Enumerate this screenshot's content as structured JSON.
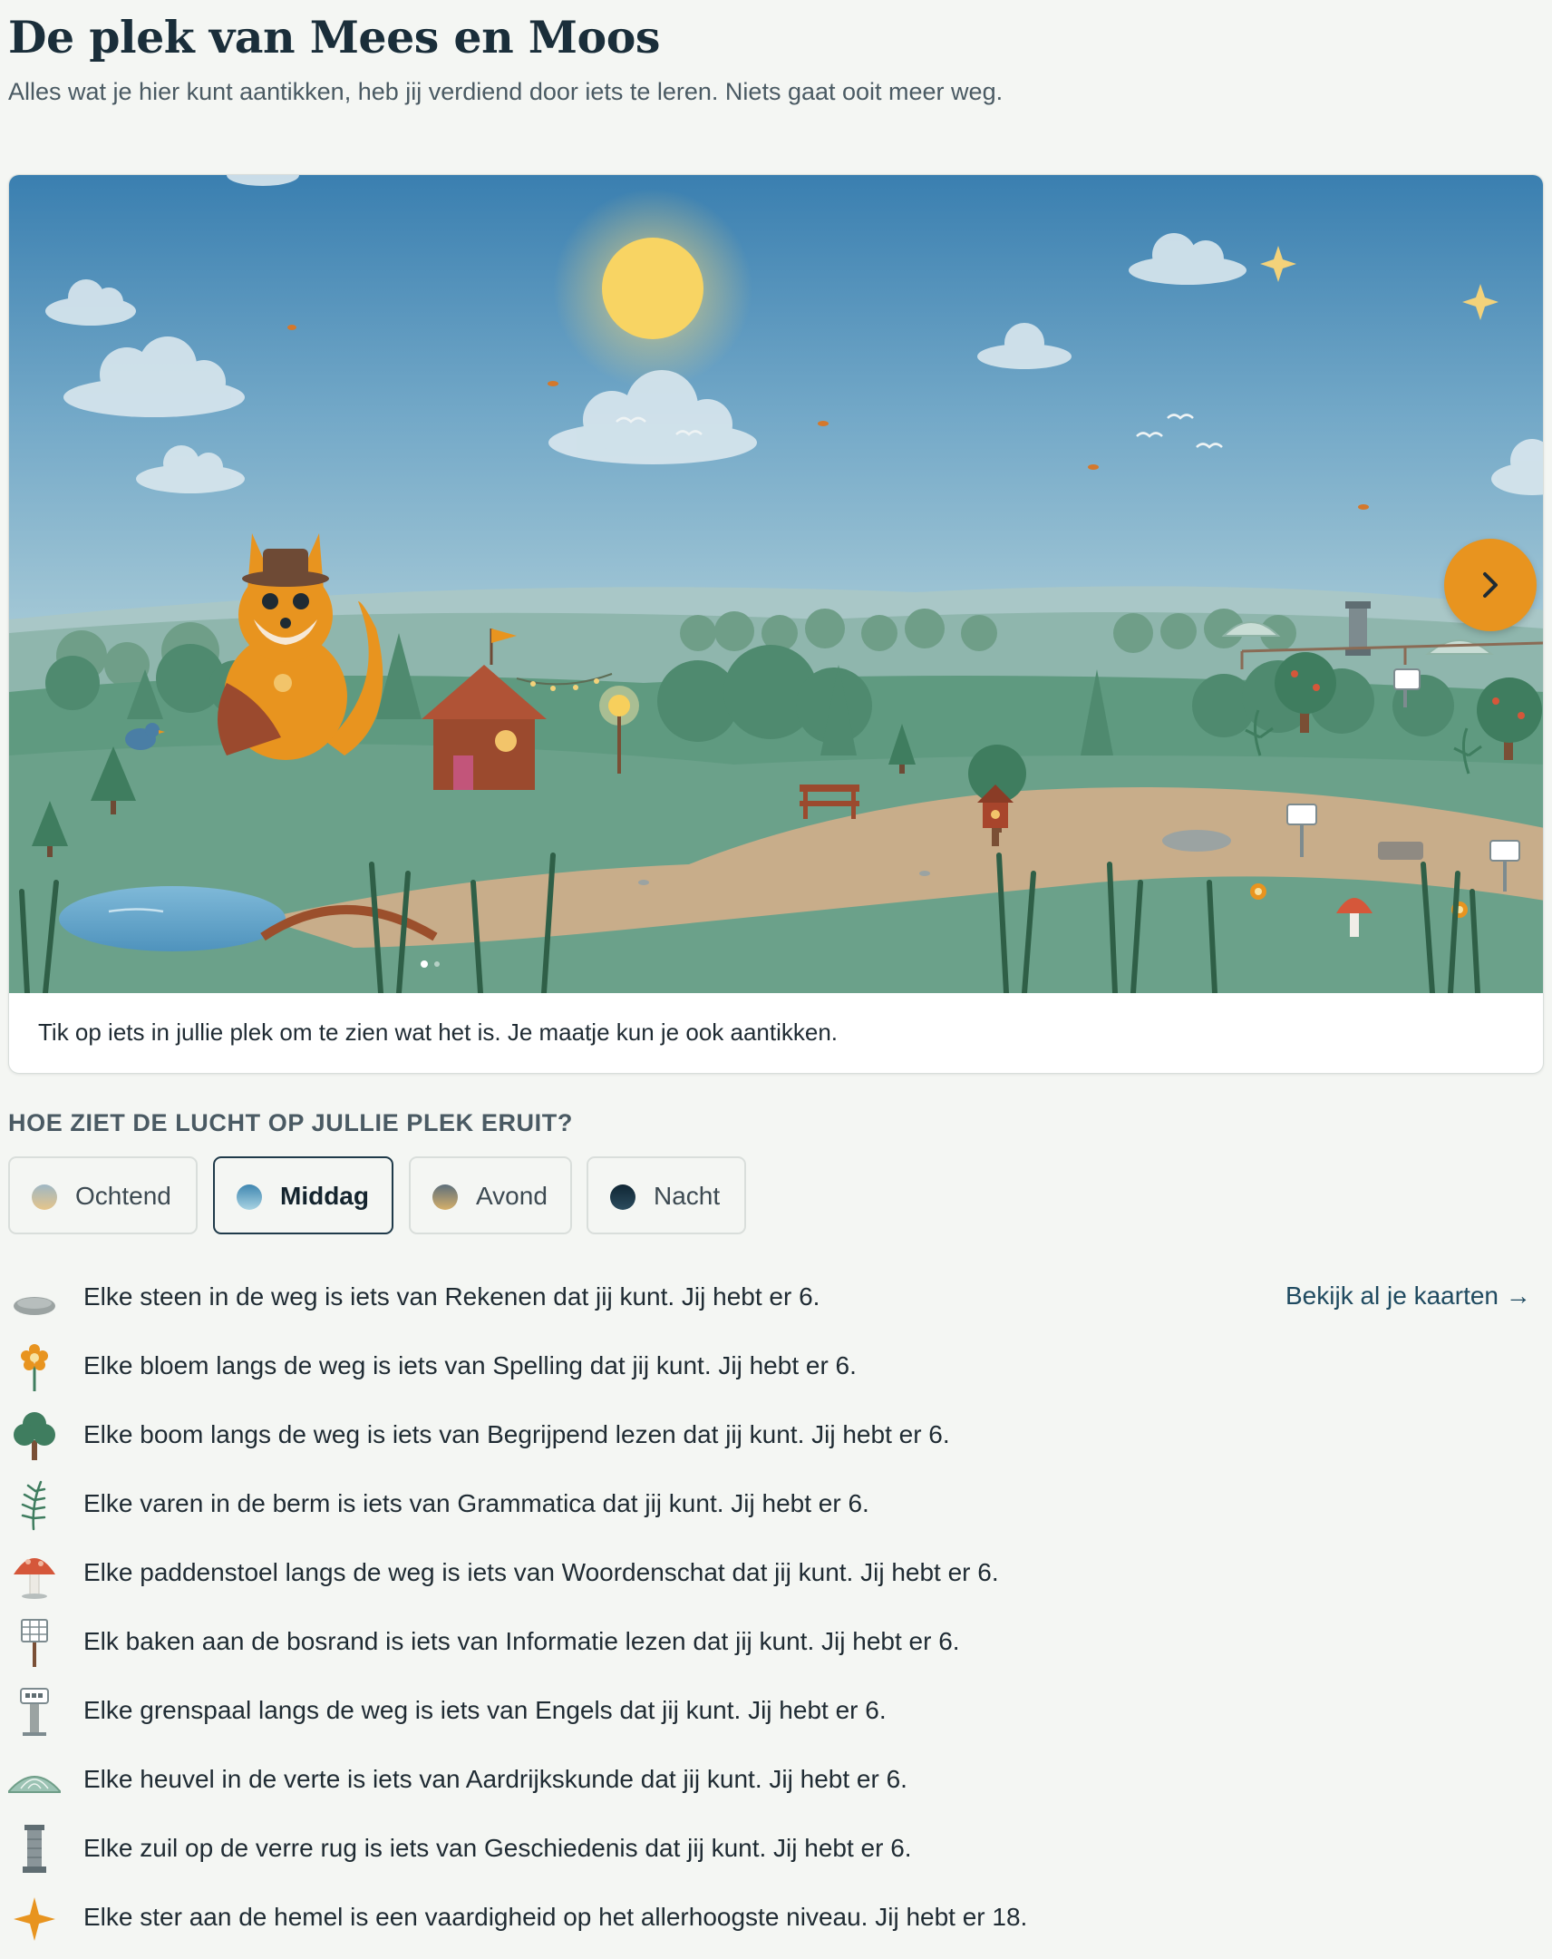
{
  "header": {
    "title": "De plek van Mees en Moos",
    "subtitle": "Alles wat je hier kunt aantikken, heb jij verdiend door iets te leren. Niets gaat ooit meer weg."
  },
  "scene": {
    "caption": "Tik op iets in jullie plek om te zien wat het is. Je maatje kun je ook aantikken.",
    "next_icon": "chevron-right-icon"
  },
  "sky": {
    "heading": "HOE ZIET DE LUCHT OP JULLIE PLEK ERUIT?",
    "selected": "Middag",
    "options": [
      {
        "label": "Ochtend",
        "color_top": "#9fb7c4",
        "color_bottom": "#e6c58a"
      },
      {
        "label": "Middag",
        "color_top": "#3f86b0",
        "color_bottom": "#a9d4e3"
      },
      {
        "label": "Avond",
        "color_top": "#5d6f7b",
        "color_bottom": "#d6b06a"
      },
      {
        "label": "Nacht",
        "color_top": "#0f2634",
        "color_bottom": "#2b4c5e"
      }
    ]
  },
  "legend": {
    "all_cards_link": "Bekijk al je kaarten →",
    "items": [
      {
        "icon": "stone-icon",
        "text": "Elke steen in de weg is iets van Rekenen dat jij kunt. Jij hebt er 6."
      },
      {
        "icon": "flower-icon",
        "text": "Elke bloem langs de weg is iets van Spelling dat jij kunt. Jij hebt er 6."
      },
      {
        "icon": "tree-icon",
        "text": "Elke boom langs de weg is iets van Begrijpend lezen dat jij kunt. Jij hebt er 6."
      },
      {
        "icon": "fern-icon",
        "text": "Elke varen in de berm is iets van Grammatica dat jij kunt. Jij hebt er 6."
      },
      {
        "icon": "mushroom-icon",
        "text": "Elke paddenstoel langs de weg is iets van Woordenschat dat jij kunt. Jij hebt er 6."
      },
      {
        "icon": "beacon-icon",
        "text": "Elk baken aan de bosrand is iets van Informatie lezen dat jij kunt. Jij hebt er 6."
      },
      {
        "icon": "boundary-post-icon",
        "text": "Elke grenspaal langs de weg is iets van Engels dat jij kunt. Jij hebt er 6."
      },
      {
        "icon": "hill-icon",
        "text": "Elke heuvel in de verte is iets van Aardrijkskunde dat jij kunt. Jij hebt er 6."
      },
      {
        "icon": "pillar-icon",
        "text": "Elke zuil op de verre rug is iets van Geschiedenis dat jij kunt. Jij hebt er 6."
      },
      {
        "icon": "star-icon",
        "text": "Elke ster aan de hemel is een vaardigheid op het allerhoogste niveau. Jij hebt er 18."
      }
    ]
  }
}
